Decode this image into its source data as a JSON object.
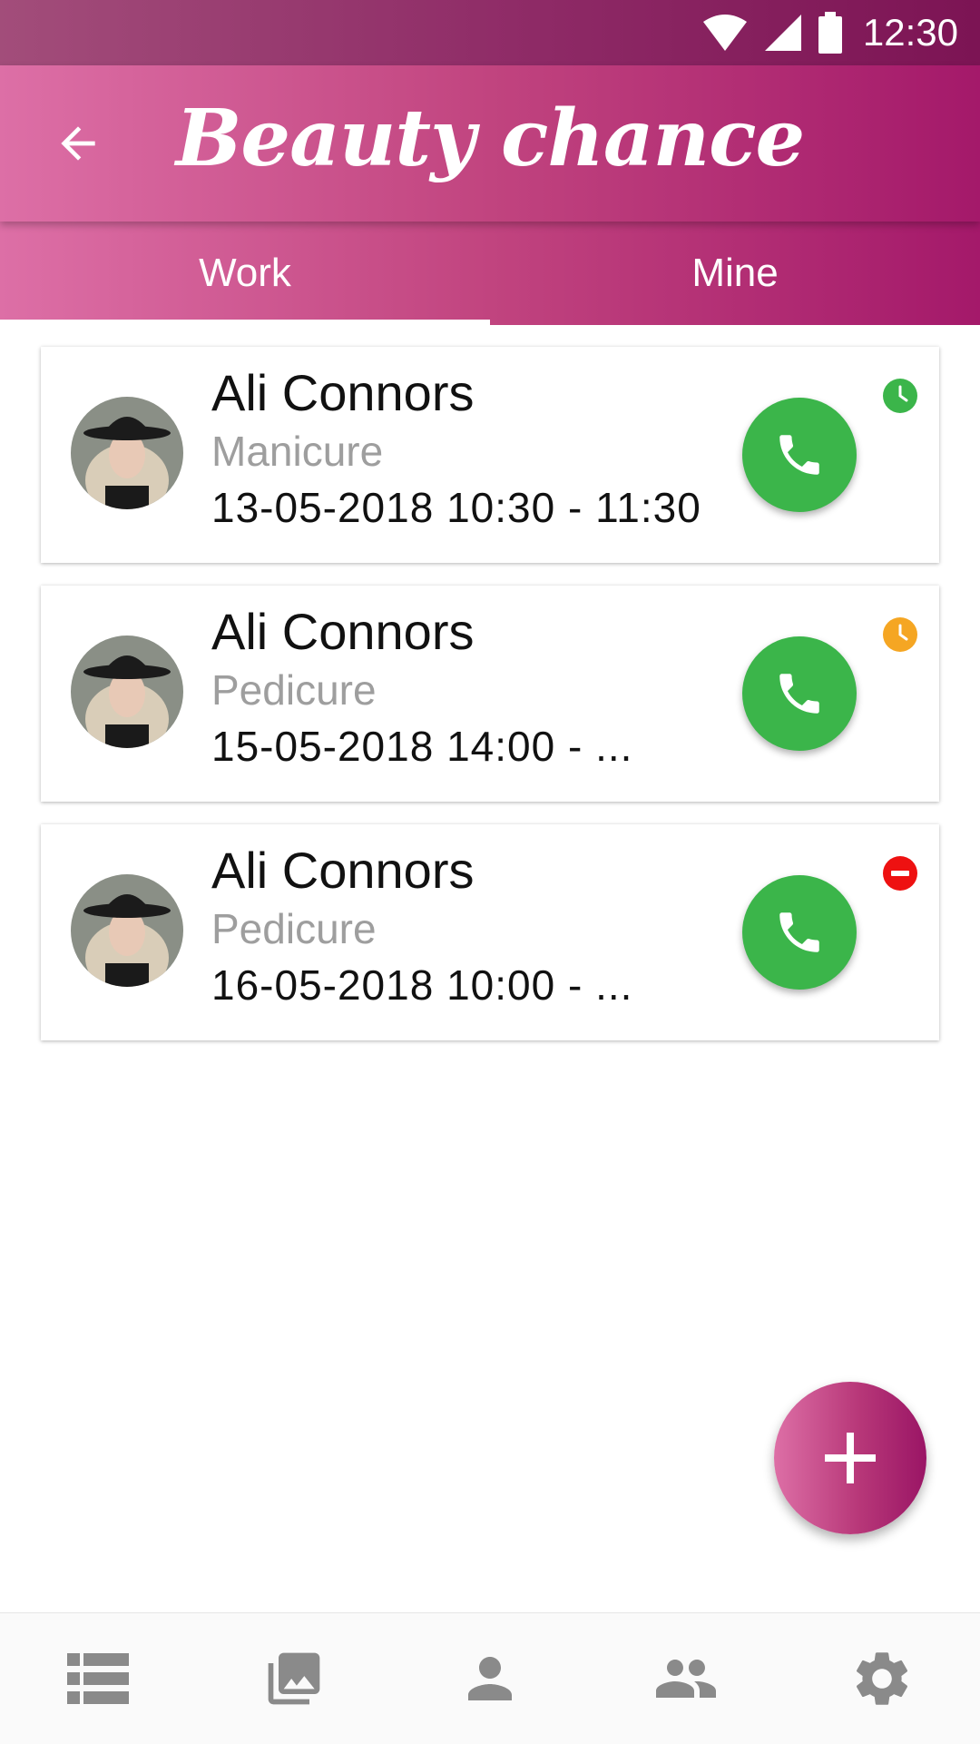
{
  "status_bar": {
    "time": "12:30"
  },
  "app_bar": {
    "title": "Beauty chance"
  },
  "tabs": [
    {
      "label": "Work",
      "active": true
    },
    {
      "label": "Mine",
      "active": false
    }
  ],
  "appointments": [
    {
      "name": "Ali Connors",
      "service": "Manicure",
      "time": "13-05-2018 10:30 - 11:30",
      "status_icon": "clock-icon",
      "status_color": "#3bb54a"
    },
    {
      "name": "Ali Connors",
      "service": "Pedicure",
      "time": "15-05-2018 14:00 - ...",
      "status_icon": "clock-icon",
      "status_color": "#f5a623"
    },
    {
      "name": "Ali Connors",
      "service": "Pedicure",
      "time": "16-05-2018 10:00 - ...",
      "status_icon": "minus-circle-icon",
      "status_color": "#ee1111"
    }
  ],
  "colors": {
    "accent_pink": "#c1447f",
    "call_green": "#3bb54a",
    "nav_icon_grey": "#8a8a8a"
  },
  "bottom_nav": [
    {
      "icon": "list-icon"
    },
    {
      "icon": "gallery-icon"
    },
    {
      "icon": "person-icon"
    },
    {
      "icon": "people-icon"
    },
    {
      "icon": "settings-icon"
    }
  ]
}
